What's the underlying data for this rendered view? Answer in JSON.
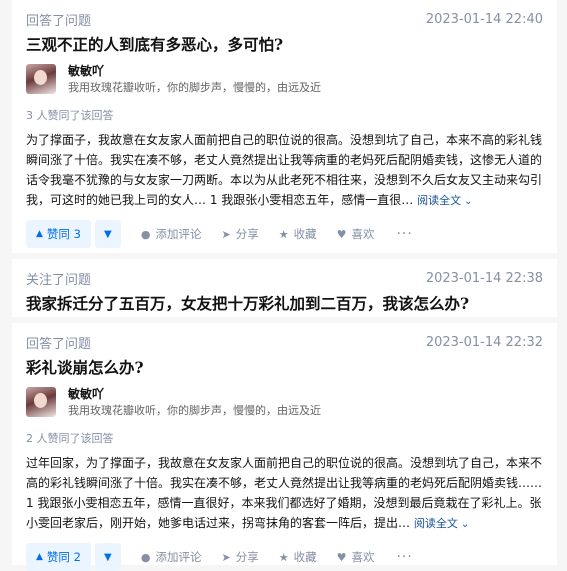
{
  "feed": [
    {
      "type": "answer",
      "action_label": "回答了问题",
      "time": "2023-01-14 22:40",
      "question": "三观不正的人到底有多恶心，多可怕?",
      "author": {
        "name": "敏敏吖",
        "bio": "我用玫瑰花瓣收听，你的脚步声，慢慢的，由远及近"
      },
      "vote_note": "3 人赞同了该回答",
      "content": "为了撑面子，我故意在女友家人面前把自己的职位说的很高。没想到坑了自己，本来不高的彩礼钱瞬间涨了十倍。我实在凑不够，老丈人竟然提出让我等病重的老妈死后配阴婚卖钱，这惨无人道的话令我毫不犹豫的与女友家一刀两断。本以为从此老死不相往来，没想到不久后女友又主动来勾引我，可这时的她已我上司的女人… 1 我跟张小雯相恋五年，感情一直很…",
      "read_more": "阅读全文",
      "upvote_label": "赞同 3",
      "actions": {
        "comment": "添加评论",
        "share": "分享",
        "favorite": "收藏",
        "like": "喜欢",
        "more": "···"
      }
    },
    {
      "type": "follow",
      "action_label": "关注了问题",
      "time": "2023-01-14 22:38",
      "question": "我家拆迁分了五百万，女友把十万彩礼加到二百万，我该怎么办?"
    },
    {
      "type": "answer",
      "action_label": "回答了问题",
      "time": "2023-01-14 22:32",
      "question": "彩礼谈崩怎么办?",
      "author": {
        "name": "敏敏吖",
        "bio": "我用玫瑰花瓣收听，你的脚步声，慢慢的，由远及近"
      },
      "vote_note": "2 人赞同了该回答",
      "content": "过年回家，为了撑面子，我故意在女友家人面前把自己的职位说的很高。没想到坑了自己，本来不高的彩礼钱瞬间涨了十倍。我实在凑不够，老丈人竟然提出让我等病重的老妈死后配阴婚卖钱…… 1 我跟张小雯相恋五年，感情一直很好，本来我们都选好了婚期，没想到最后竟栽在了彩礼上。张小雯回老家后，刚开始，她爹电话过来，拐弯抹角的客套一阵后，提出…",
      "read_more": "阅读全文",
      "upvote_label": "赞同 2",
      "actions": {
        "comment": "添加评论",
        "share": "分享",
        "favorite": "收藏",
        "like": "喜欢",
        "more": "···"
      }
    }
  ],
  "icons": {
    "upvote": "triangle-up-icon",
    "downvote": "triangle-down-icon",
    "comment": "comment-bubble-icon",
    "share": "paper-plane-icon",
    "favorite": "star-icon",
    "like": "heart-icon",
    "expand": "chevron-down-icon"
  },
  "colors": {
    "accent": "#056de8",
    "accent_bg": "#ebf5ff",
    "meta": "#8590a6",
    "link": "#175199"
  }
}
